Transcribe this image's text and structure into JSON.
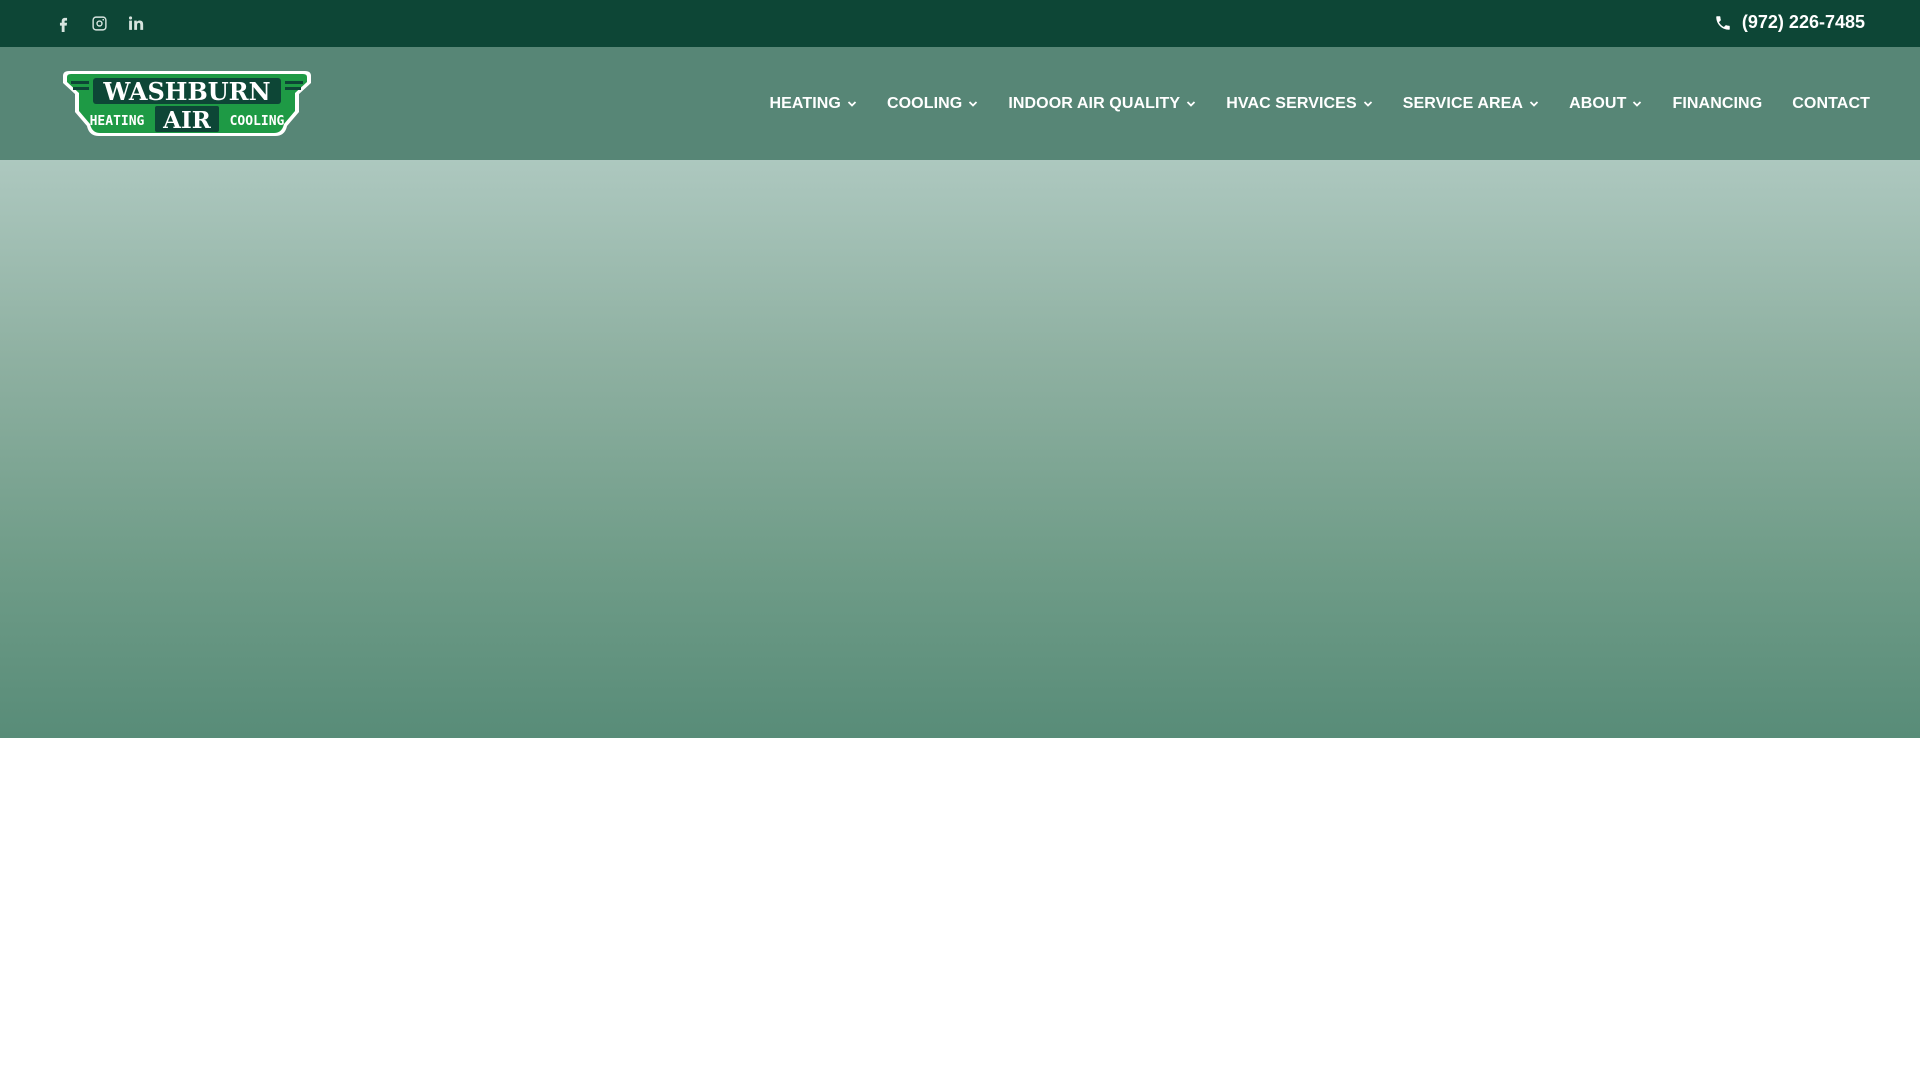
{
  "topbar": {
    "social": [
      {
        "name": "facebook-icon"
      },
      {
        "name": "instagram-icon"
      },
      {
        "name": "linkedin-icon"
      }
    ],
    "phone": "(972) 226-7485"
  },
  "logo": {
    "line1": "WASHBURN",
    "left": "HEATING",
    "center": "AIR",
    "right": "COOLING",
    "colors": {
      "green": "#1e9a45",
      "dark": "#0d4636",
      "white": "#ffffff"
    }
  },
  "nav": {
    "items": [
      {
        "label": "HEATING",
        "dropdown": true
      },
      {
        "label": "COOLING",
        "dropdown": true
      },
      {
        "label": "INDOOR AIR QUALITY",
        "dropdown": true
      },
      {
        "label": "HVAC SERVICES",
        "dropdown": true
      },
      {
        "label": "SERVICE AREA",
        "dropdown": true
      },
      {
        "label": "ABOUT",
        "dropdown": true
      },
      {
        "label": "FINANCING",
        "dropdown": false
      },
      {
        "label": "CONTACT",
        "dropdown": false
      }
    ]
  },
  "theme": {
    "topbar": "#0d4636",
    "navbar": "#578676",
    "hero_top": "#adc8bf",
    "hero_bottom": "#588c78"
  }
}
